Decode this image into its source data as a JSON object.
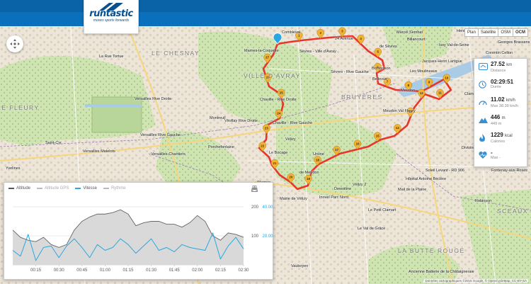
{
  "brand": {
    "name": "runtastic",
    "tagline": "moves sports forwards",
    "color": "#0b4f8c",
    "topbar_color": "#0a63a6"
  },
  "map": {
    "type_buttons": [
      {
        "label": "Plan",
        "active": false
      },
      {
        "label": "Satellite",
        "active": false
      },
      {
        "label": "OSM",
        "active": false
      },
      {
        "label": "OCM",
        "active": true
      }
    ],
    "route_color": "#e8352c",
    "marker_color": "#f2b233",
    "regions": [
      "LE CHESNAY",
      "VILLE-D'AVRAY",
      "BRUYÈRES",
      "LE FLEURY",
      "SCEAUX",
      "LA BUTTE ROUGE"
    ],
    "places": [
      "Combleval",
      "Marnes-la-Coquette",
      "Sèvres - Ville d'Avray",
      "24 Avenue",
      "Marcel Sembat",
      "Henri Farman",
      "Issy Val-de-Seine",
      "Billancourt",
      "de Sèvres",
      "Corentin Celton",
      "Georges Brassens",
      "La Rue Tortue",
      "Jacques-Henri Lartigue",
      "Les Moulineaux",
      "Brimborion",
      "Sèvres - Rive Gauche",
      "Bellevue",
      "Meudon",
      "Clamart",
      "Versailles Rive Droite",
      "Montreuil",
      "Viroflay Rive Droite",
      "Chaville - Rive Droite",
      "Chaville - Rive Gauche",
      "Meudon Val Fleury",
      "Versailles Rive Gauche",
      "Porchefontaine",
      "Saint-Cyr",
      "Versailles Matelots",
      "Versailles-Chantiers",
      "Vélizy",
      "Ursine",
      "de Meudon",
      "Le Bocage",
      "Division",
      "Soleil Levant - RD 906",
      "Hôpital Antoine Béclère",
      "Mail de la Plaine",
      "Fontenay-aux-Roses",
      "Dewoitine",
      "Vélizy 2",
      "Inovel Parc Nord",
      "Mairie de Vélizy",
      "Le Petit Clamart",
      "Robinson",
      "Le Val de Grâce",
      "Vauboyen",
      "Ancienne Batterie de la Châtaigneraie",
      "Yvelines",
      "Wagner",
      "Clamart"
    ],
    "copyright": "Données cartographiques ©2015 Google, © OpenCycleMap, CC-BY-SA",
    "km_markers": [
      "1",
      "2",
      "3",
      "4",
      "5",
      "6",
      "7",
      "8",
      "9",
      "10",
      "11",
      "12",
      "13",
      "14",
      "15",
      "16",
      "17",
      "18",
      "19",
      "20",
      "21",
      "22",
      "23",
      "24",
      "25",
      "26",
      "27"
    ]
  },
  "stats": {
    "distance": {
      "value": "27.52",
      "unit": "km",
      "label": "Distance",
      "icon": "route-icon"
    },
    "duration": {
      "value": "02:29:51",
      "label": "Durée",
      "icon": "clock-icon"
    },
    "speed": {
      "value": "11.02",
      "unit": "km/h",
      "label": "Max 38.39 km/h",
      "icon": "speedometer-icon"
    },
    "elevation": {
      "value": "446",
      "unit": "m",
      "label": "449 m",
      "icon": "mountain-icon"
    },
    "calories": {
      "value": "1229",
      "unit": "kcal",
      "label": "Calories",
      "icon": "flame-icon"
    },
    "heart_rate": {
      "value": "-",
      "label": "Max -",
      "icon": "heart-icon"
    }
  },
  "chart": {
    "legend": [
      {
        "label": "Altitude",
        "color": "#555555",
        "active": true
      },
      {
        "label": "Altitude GPS",
        "color": "#bbbbbb",
        "active": false
      },
      {
        "label": "Vitesse",
        "color": "#29a8df",
        "active": true
      },
      {
        "label": "Rythme",
        "color": "#bbbbbb",
        "active": false
      }
    ],
    "tools": [
      "print-icon",
      "download-icon"
    ]
  },
  "chart_data": {
    "type": "line",
    "x": [
      "00:15",
      "00:30",
      "00:45",
      "01:00",
      "01:15",
      "01:30",
      "01:45",
      "02:00",
      "02:15",
      "02:30"
    ],
    "x_minutes": [
      0,
      5,
      10,
      15,
      20,
      25,
      30,
      35,
      40,
      45,
      50,
      55,
      60,
      65,
      70,
      75,
      80,
      85,
      90,
      95,
      100,
      105,
      110,
      115,
      120,
      125,
      130,
      135,
      140,
      145,
      150
    ],
    "series": [
      {
        "name": "Altitude",
        "axis": "left",
        "color": "#666666",
        "values": [
          120,
          95,
          85,
          80,
          95,
          70,
          60,
          70,
          120,
          150,
          165,
          175,
          175,
          180,
          190,
          175,
          135,
          145,
          150,
          150,
          140,
          140,
          130,
          145,
          170,
          150,
          100,
          85,
          110,
          105,
          95
        ]
      },
      {
        "name": "Vitesse",
        "axis": "right",
        "color": "#29a8df",
        "values": [
          10,
          6,
          21,
          3,
          12,
          13,
          5,
          13,
          18,
          12,
          5,
          14,
          10,
          12,
          18,
          14,
          8,
          13,
          18,
          10,
          12,
          9,
          14,
          12,
          11,
          10,
          22,
          4,
          13,
          19,
          11
        ]
      }
    ],
    "y_left": {
      "ticks": [
        100,
        200
      ],
      "range": [
        0,
        200
      ]
    },
    "y_right": {
      "ticks": [
        "20.00",
        "40.00"
      ],
      "range": [
        0,
        40
      ]
    },
    "grid": true
  }
}
